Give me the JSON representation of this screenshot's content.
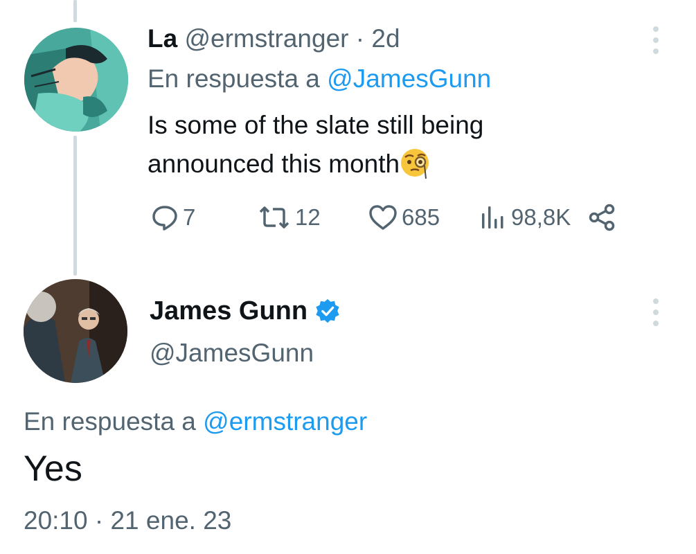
{
  "reply_tweet": {
    "display_name": "La",
    "handle": "@ermstranger",
    "separator": "·",
    "age": "2d",
    "reply_to_prefix": "En respuesta a",
    "reply_to_handle": "@JamesGunn",
    "text": "Is some of the slate still being announced this month",
    "emoji": "face-with-monocle-emoji",
    "actions": {
      "replies": "7",
      "retweets": "12",
      "likes": "685",
      "views": "98,8K"
    }
  },
  "main_tweet": {
    "display_name": "James Gunn",
    "handle": "@JamesGunn",
    "verified": true,
    "reply_to_prefix": "En respuesta a",
    "reply_to_handle": "@ermstranger",
    "text": "Yes",
    "time": "20:10",
    "separator": "·",
    "date": "21 ene. 23"
  },
  "colors": {
    "link": "#1d9bf0",
    "secondary_text": "#536471",
    "thread_line": "#cfd9de",
    "primary_text": "#0f1419"
  },
  "icons": {
    "reply": "speech-bubble-icon",
    "retweet": "retweet-arrows-icon",
    "like": "heart-icon",
    "views": "bar-chart-icon",
    "share": "share-nodes-icon",
    "more": "vertical-dots-icon",
    "verified": "verified-badge-icon"
  }
}
